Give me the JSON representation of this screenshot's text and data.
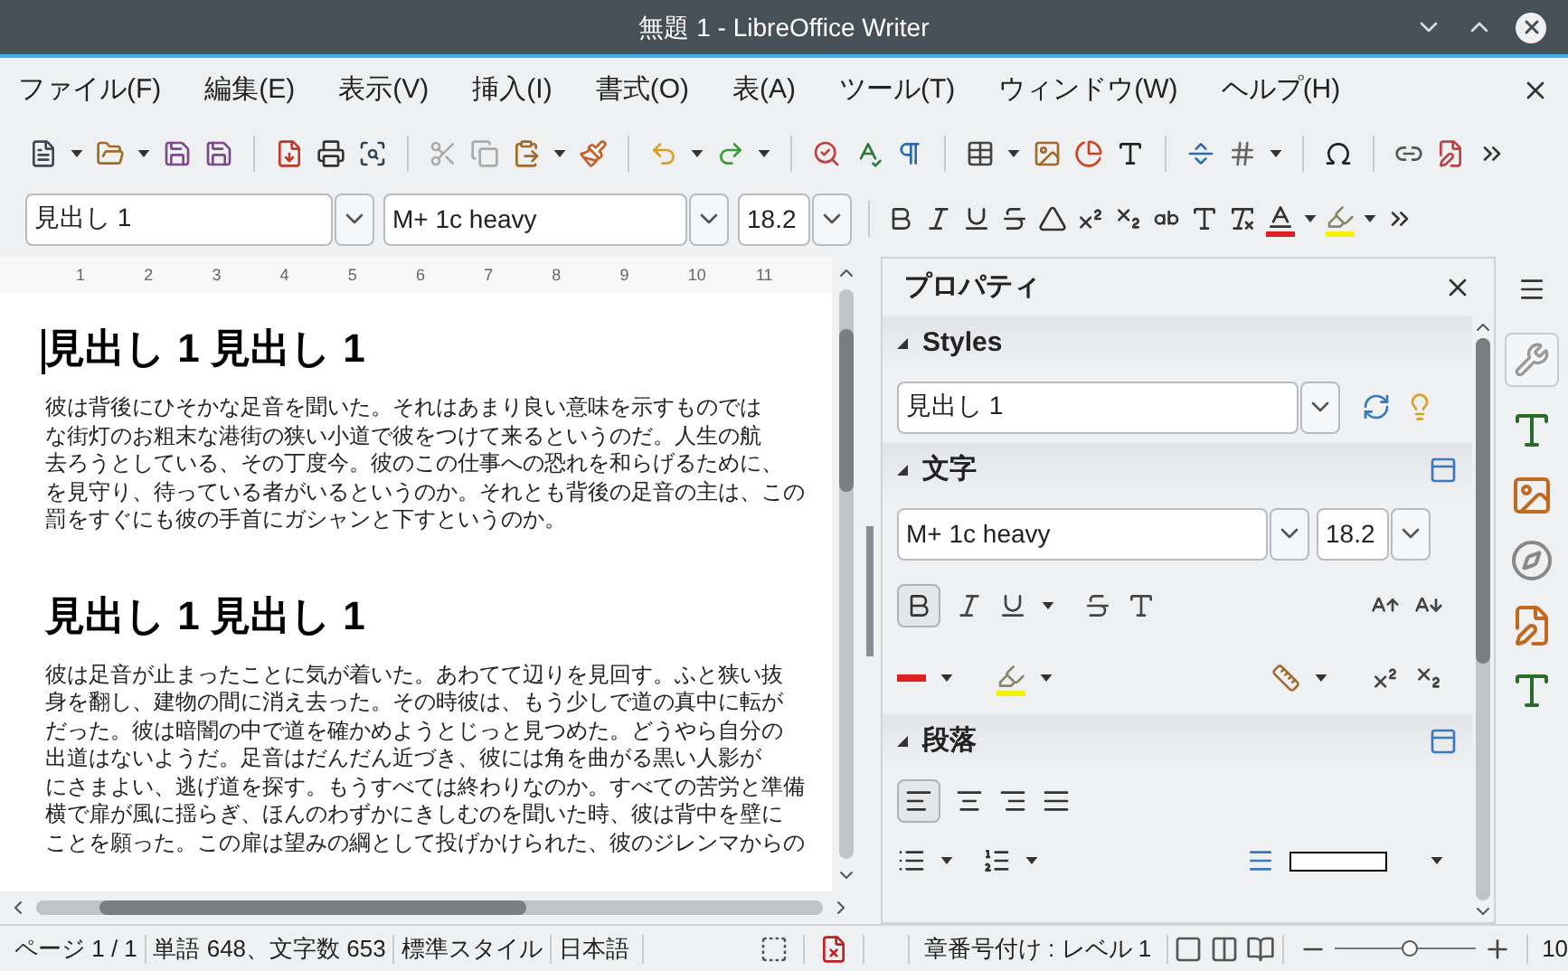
{
  "window": {
    "title": "無題 1 - LibreOffice Writer"
  },
  "menu": [
    "ファイル(F)",
    "編集(E)",
    "表示(V)",
    "挿入(I)",
    "書式(O)",
    "表(A)",
    "ツール(T)",
    "ウィンドウ(W)",
    "ヘルプ(H)"
  ],
  "formatting": {
    "style": "見出し 1",
    "font": "M+ 1c heavy",
    "size": "18.2"
  },
  "ruler": {
    "ticks": [
      "1",
      "2",
      "3",
      "4",
      "5",
      "6",
      "7",
      "8",
      "9",
      "10",
      "11"
    ]
  },
  "document": {
    "blocks": [
      {
        "kind": "heading",
        "text": "見出し 1 見出し 1"
      },
      {
        "kind": "paragraph",
        "lines": [
          "彼は背後にひそかな足音を聞いた。それはあまり良い意味を示すものでは",
          "な街灯のお粗末な港街の狭い小道で彼をつけて来るというのだ。人生の航",
          "去ろうとしている、その丁度今。彼のこの仕事への恐れを和らげるために、",
          "を見守り、待っている者がいるというのか。それとも背後の足音の主は、この",
          "罰をすぐにも彼の手首にガシャンと下すというのか。"
        ]
      },
      {
        "kind": "heading",
        "text": "見出し 1 見出し 1"
      },
      {
        "kind": "paragraph",
        "lines": [
          "彼は足音が止まったことに気が着いた。あわてて辺りを見回す。ふと狭い抜",
          "身を翻し、建物の間に消え去った。その時彼は、もう少しで道の真中に転が",
          "だった。彼は暗闇の中で道を確かめようとじっと見つめた。どうやら自分の",
          "出道はないようだ。足音はだんだん近づき、彼には角を曲がる黒い人影が",
          "にさまよい、逃げ道を探す。もうすべては終わりなのか。すべての苦労と準備",
          "横で扉が風に揺らぎ、ほんのわずかにきしむのを聞いた時、彼は背中を壁に",
          "ことを願った。この扉は望みの綱として投げかけられた、彼のジレンマからの"
        ]
      }
    ]
  },
  "sidebar": {
    "title": "プロパティ",
    "styles": {
      "title": "Styles",
      "style": "見出し 1",
      "expanded": true
    },
    "character": {
      "title": "文字",
      "font": "M+ 1c heavy",
      "size": "18.2",
      "expanded": true,
      "bold": true
    },
    "paragraph": {
      "title": "段落",
      "expanded": true,
      "align_left": true
    }
  },
  "status_bar": {
    "page": "ページ 1 / 1",
    "words": "単語 648、文字数 653",
    "page_style": "標準スタイル",
    "language": "日本語",
    "outline": "章番号付け : レベル 1",
    "zoom": {
      "level": 0.52,
      "reading": "10"
    }
  }
}
